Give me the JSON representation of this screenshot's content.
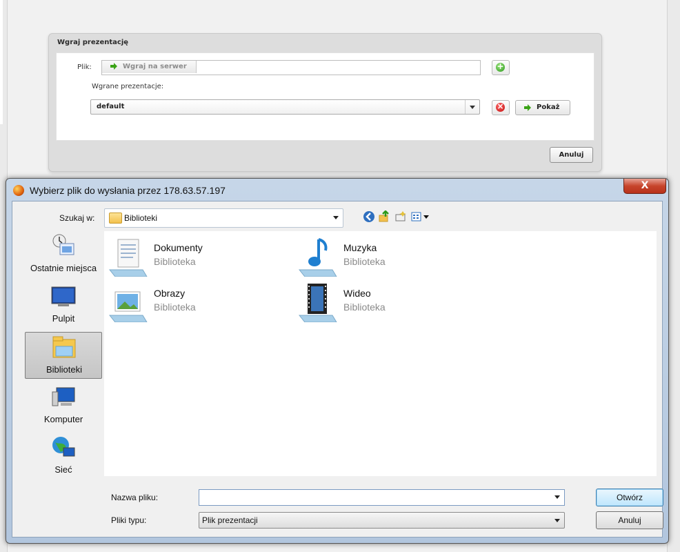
{
  "web": {
    "panel_title": "Wgraj prezentację",
    "file_label": "Plik:",
    "upload_button": "Wgraj na serwer",
    "uploaded_label": "Wgrane prezentacje:",
    "selected_presentation": "default",
    "show_button": "Pokaż",
    "cancel_button": "Anuluj",
    "add_icon": "+",
    "delete_icon": "×"
  },
  "dialog": {
    "title": "Wybierz plik do wysłania przez 178.63.57.197",
    "close_label": "X",
    "lookin_label": "Szukaj w:",
    "lookin_value": "Biblioteki",
    "places": [
      {
        "label": "Ostatnie miejsca",
        "icon": "recent-places-icon"
      },
      {
        "label": "Pulpit",
        "icon": "desktop-icon"
      },
      {
        "label": "Biblioteki",
        "icon": "libraries-icon",
        "selected": true
      },
      {
        "label": "Komputer",
        "icon": "computer-icon"
      },
      {
        "label": "Sieć",
        "icon": "network-icon"
      }
    ],
    "items": [
      {
        "name": "Dokumenty",
        "type": "Biblioteka",
        "icon": "documents-library-icon"
      },
      {
        "name": "Muzyka",
        "type": "Biblioteka",
        "icon": "music-library-icon"
      },
      {
        "name": "Obrazy",
        "type": "Biblioteka",
        "icon": "pictures-library-icon"
      },
      {
        "name": "Wideo",
        "type": "Biblioteka",
        "icon": "video-library-icon"
      }
    ],
    "filename_label": "Nazwa pliku:",
    "filename_value": "",
    "filetype_label": "Pliki typu:",
    "filetype_value": "Plik prezentacji",
    "open_button": "Otwórz",
    "cancel_button": "Anuluj"
  }
}
